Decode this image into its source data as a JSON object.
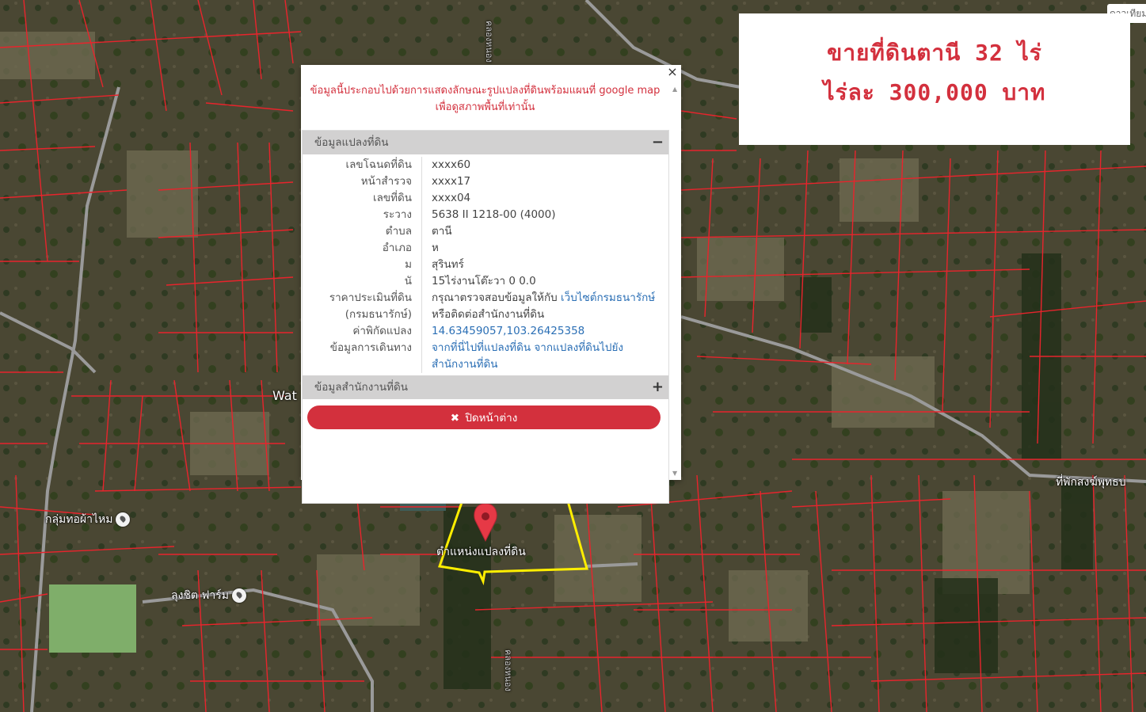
{
  "map": {
    "labels": {
      "wat": "Wat",
      "group_weaving": "กลุ่มทอผ้าไหม",
      "lung_chit_farm": "ลุงชิต ฟาร์ม",
      "monk_residence": "ที่พักสงฆ์พุทธบ",
      "parcel_location": "ตำแหน่งแปลงที่ดิน",
      "canal_top": "คลองหนอง",
      "canal_bottom": "คลองหนอง"
    },
    "top_right_tab": "ดาวเทียม",
    "colors": {
      "parcel_lines": "#e8242c",
      "highlight": "#ffee00",
      "marker": "#e63946"
    }
  },
  "price_card": {
    "line1": "ขายที่ดินตานี 32  ไร่",
    "line2": "ไร่ละ 300,000  บาท",
    "color": "#d3303d"
  },
  "info_window": {
    "close_symbol": "×",
    "notice_line1": "ข้อมูลนี้ประกอบไปด้วยการแสดงลักษณะรูปแปลงที่ดินพร้อมแผนที่ google map",
    "notice_line2": "เพื่อดูสภาพพื้นที่เท่านั้น",
    "section1": {
      "title": "ข้อมูลแปลงที่ดิน",
      "toggle": "−"
    },
    "rows": [
      {
        "key": "เลขโฉนดที่ดิน",
        "value": "xxxx60"
      },
      {
        "key": "หน้าสำรวจ",
        "value": "xxxx17"
      },
      {
        "key": "เลขที่ดิน",
        "value": "xxxx04"
      },
      {
        "key": "ระวาง",
        "value": "5638 II 1218-00 (4000)"
      },
      {
        "key": "ตำบล",
        "value": "ตานี"
      },
      {
        "key": "อำเภอ",
        "value": "ห"
      },
      {
        "key": "ม",
        "value": "สุรินทร์"
      },
      {
        "key": "นั",
        "value": "15ไร่งานโต๊ะวา 0 0.0"
      }
    ],
    "appraisal": {
      "key1": "ราคาประเมินที่ดิน",
      "key2": "(กรมธนารักษ์)",
      "text1": "กรุณาตรวจสอบข้อมูลให้กับ ",
      "link": "เว็บไซต์กรมธนารักษ์",
      "text2": "หรือติดต่อสำนักงานที่ดิน"
    },
    "coords": {
      "key": "ค่าพิกัดแปลง",
      "value": "14.63459057,103.26425358"
    },
    "directions": {
      "key": "ข้อมูลการเดินทาง",
      "link1": "จากที่นี่ไปที่แปลงที่ดิน",
      "link2": "จากแปลงที่ดินไปยังสำนักงานที่ดิน"
    },
    "section2": {
      "title": "ข้อมูลสำนักงานที่ดิน",
      "toggle": "+"
    },
    "close_button": {
      "icon": "✖",
      "label": "ปิดหน้าต่าง",
      "color": "#d3303d"
    }
  }
}
